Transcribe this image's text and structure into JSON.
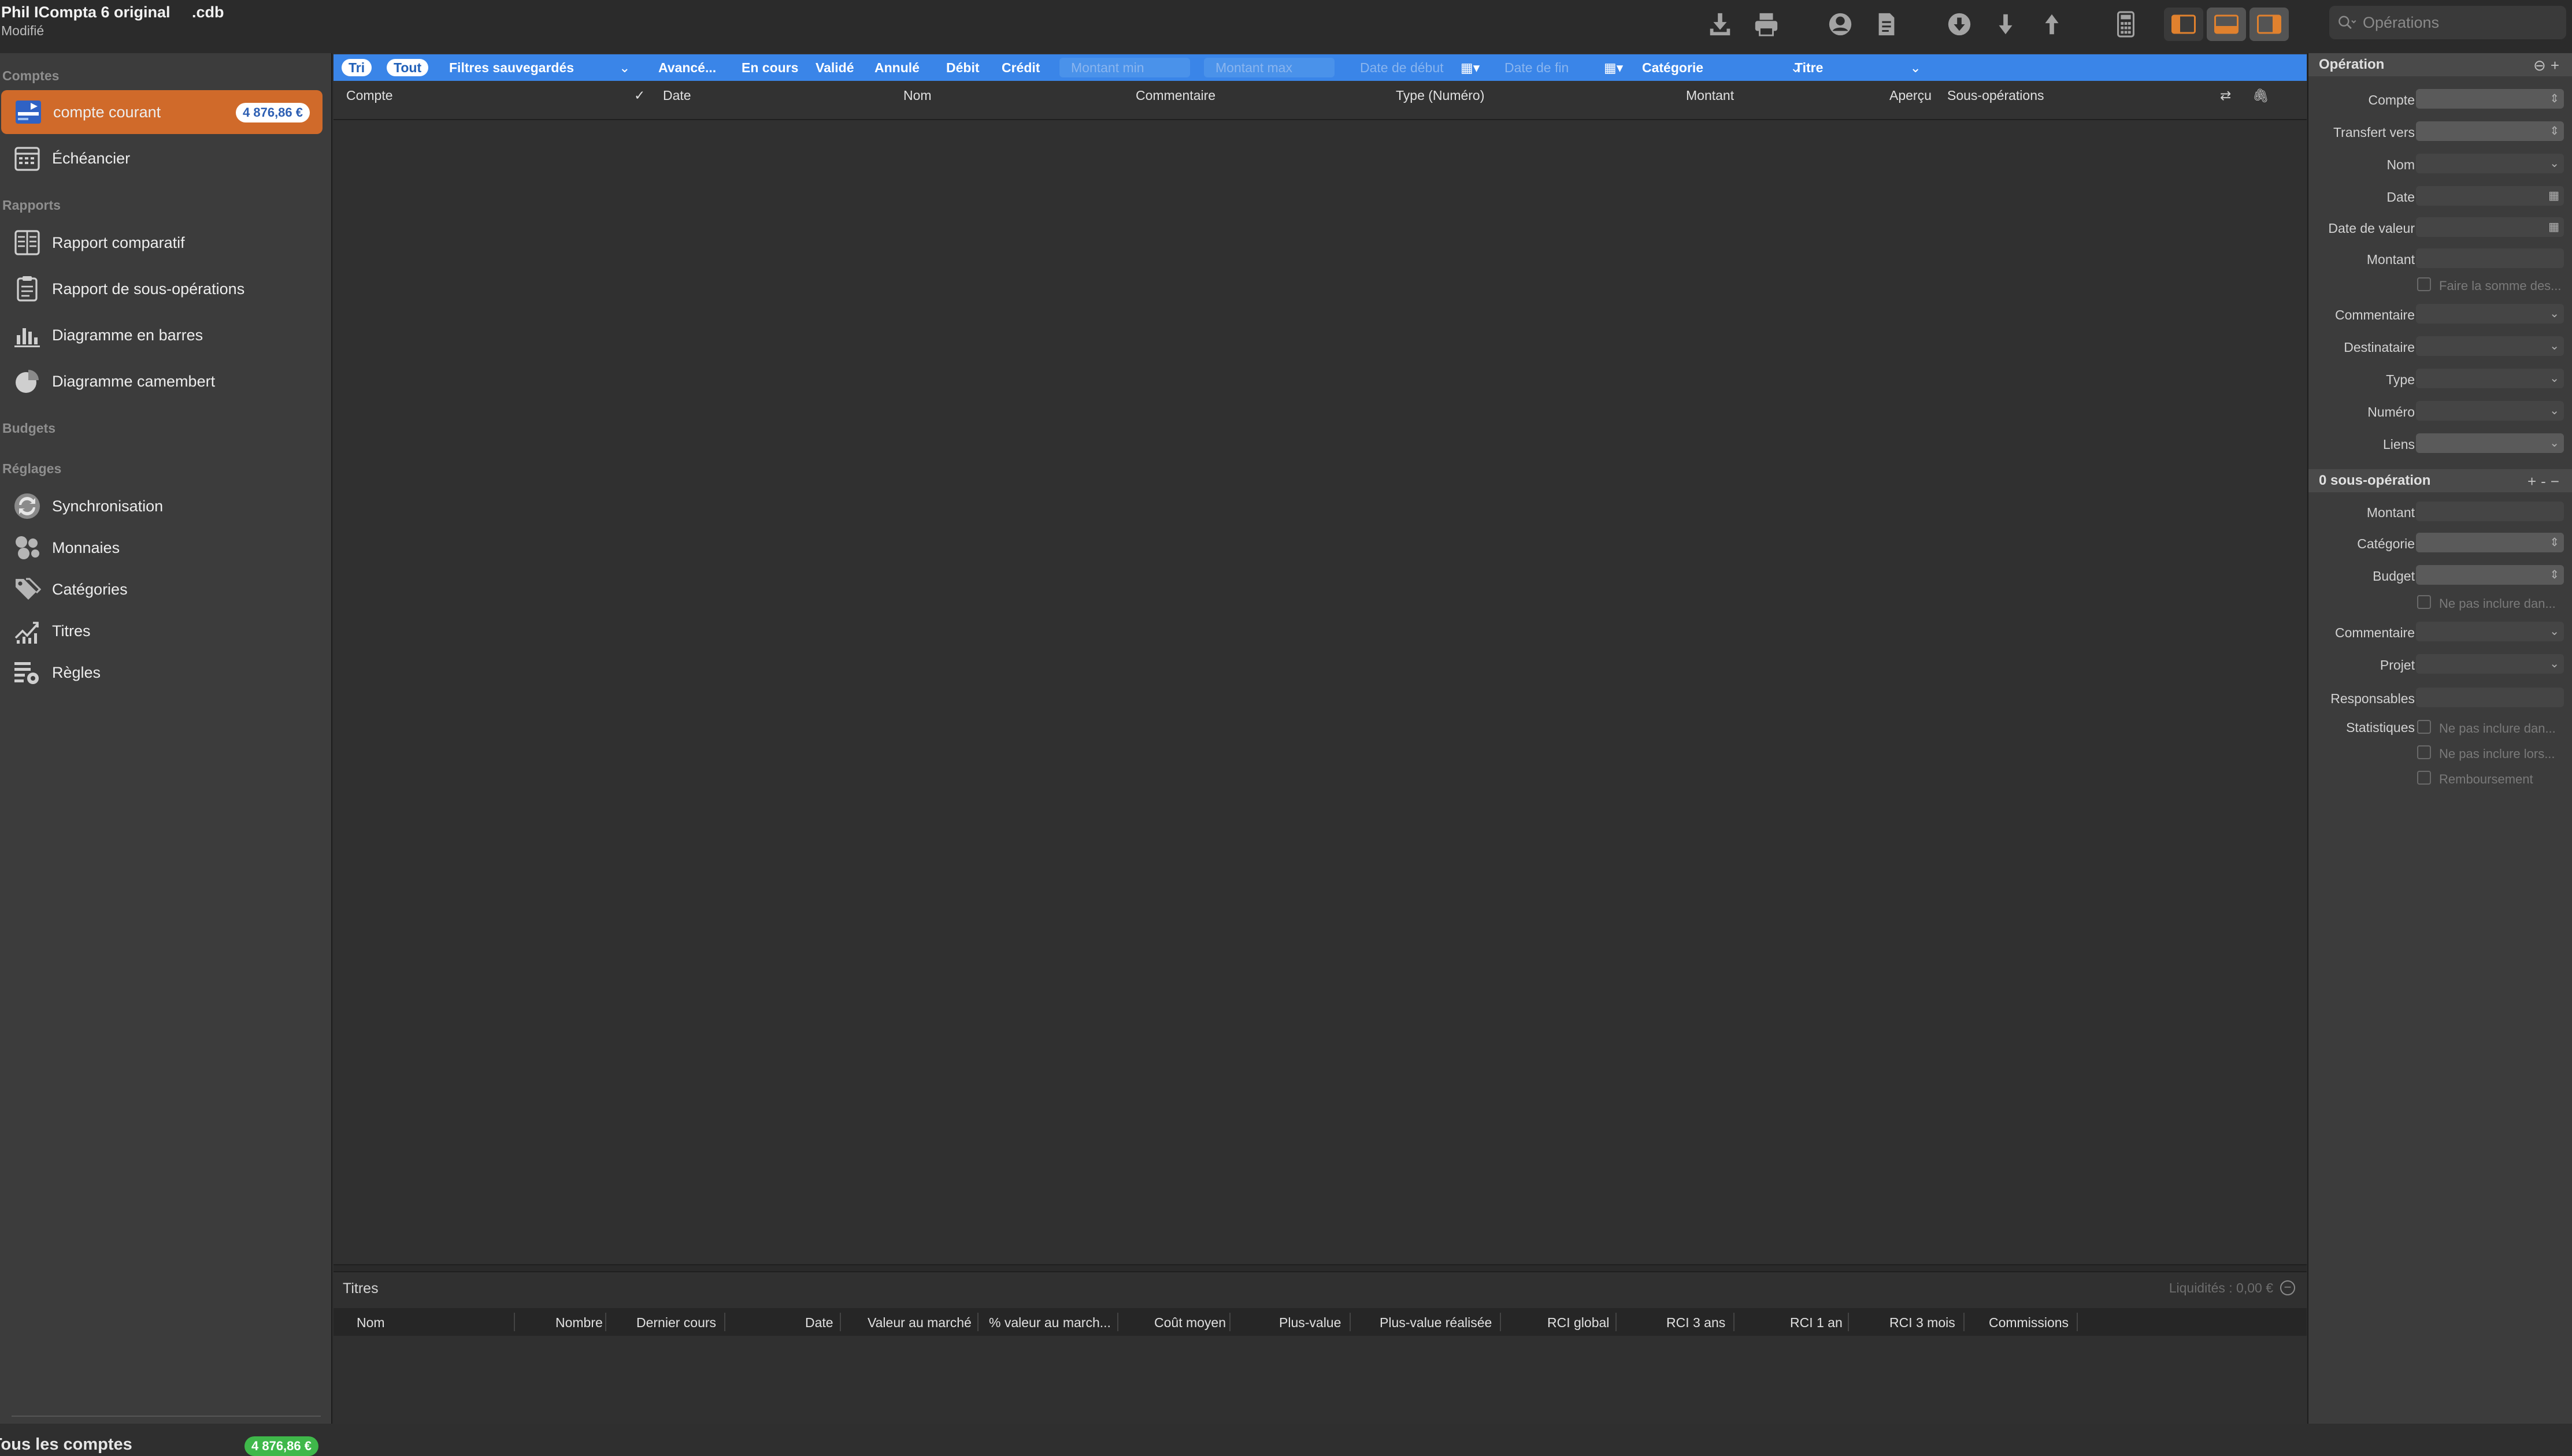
{
  "window": {
    "title": "Phil ICompta 6 original     .cdb",
    "subtitle": "Modifié"
  },
  "search": {
    "placeholder": "Opérations"
  },
  "sidebar": {
    "sections": {
      "comptes": "Comptes",
      "rapports": "Rapports",
      "budgets": "Budgets",
      "reglages": "Réglages"
    },
    "items": [
      {
        "label": "compte courant",
        "badge": "4 876,86 €"
      },
      {
        "label": "Échéancier"
      },
      {
        "label": "Rapport comparatif"
      },
      {
        "label": "Rapport de sous-opérations"
      },
      {
        "label": "Diagramme en barres"
      },
      {
        "label": "Diagramme camembert"
      },
      {
        "label": "Synchronisation"
      },
      {
        "label": "Monnaies"
      },
      {
        "label": "Catégories"
      },
      {
        "label": "Titres"
      },
      {
        "label": "Règles"
      }
    ],
    "footer": {
      "label": "Tous les comptes",
      "badge": "4 876,86 €"
    }
  },
  "filters": {
    "tri": "Tri",
    "tout": "Tout",
    "saved": "Filtres sauvegardés",
    "advanced": "Avancé...",
    "en_cours": "En cours",
    "valide": "Validé",
    "annule": "Annulé",
    "debit": "Débit",
    "credit": "Crédit",
    "montant_min": "Montant min",
    "montant_max": "Montant max",
    "date_debut": "Date de début",
    "date_fin": "Date de fin",
    "categorie": "Catégorie",
    "titre": "Titre"
  },
  "columns": {
    "compte": "Compte",
    "check": "✓",
    "date": "Date",
    "nom": "Nom",
    "commentaire": "Commentaire",
    "type": "Type (Numéro)",
    "montant": "Montant",
    "apercu": "Aperçu",
    "sous_operations": "Sous-opérations"
  },
  "titres": {
    "title": "Titres",
    "liquidites": "Liquidités : 0,00 €",
    "columns": {
      "nom": "Nom",
      "nombre": "Nombre",
      "dernier_cours": "Dernier cours",
      "date": "Date",
      "valeur_marche": "Valeur au marché",
      "pct_valeur": "% valeur au march...",
      "cout_moyen": "Coût moyen",
      "plus_value": "Plus-value",
      "plus_value_realisee": "Plus-value réalisée",
      "rci_global": "RCI global",
      "rci_3ans": "RCI 3 ans",
      "rci_1an": "RCI 1 an",
      "rci_3mois": "RCI 3 mois",
      "commissions": "Commissions"
    }
  },
  "inspector": {
    "operation_title": "Opération",
    "fields": {
      "compte": "Compte",
      "transfert": "Transfert vers",
      "nom": "Nom",
      "date": "Date",
      "date_valeur": "Date de valeur",
      "montant": "Montant",
      "faire_somme": "Faire la somme des...",
      "commentaire": "Commentaire",
      "destinataire": "Destinataire",
      "type": "Type",
      "numero": "Numéro",
      "liens": "Liens"
    },
    "sub_title": "0 sous-opération",
    "sub": {
      "montant": "Montant",
      "categorie": "Catégorie",
      "budget": "Budget",
      "ne_pas_inclure_budget": "Ne pas inclure dan...",
      "commentaire": "Commentaire",
      "projet": "Projet",
      "responsables": "Responsables",
      "statistiques": "Statistiques",
      "ne_pas_inclure_stats": "Ne pas inclure dan...",
      "ne_pas_inclure_lors": "Ne pas inclure lors...",
      "remboursement": "Remboursement"
    }
  }
}
